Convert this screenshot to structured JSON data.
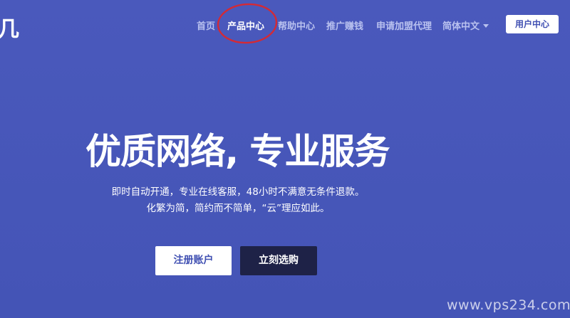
{
  "header": {
    "logo_fragment": "几",
    "nav": {
      "home": "首页",
      "products": "产品中心",
      "help": "帮助中心",
      "affiliate": "推广赚钱",
      "agent": "申请加盟代理",
      "language": "简体中文"
    },
    "user_center": "用户中心"
  },
  "hero": {
    "title": "优质网络, 专业服务",
    "subtitle_line1": "即时自动开通，专业在线客服，48小时不满意无条件退款。",
    "subtitle_line2": "化繁为简，简约而不简单，“云”理应如此。",
    "register_button": "注册账户",
    "buy_button": "立刻选购"
  },
  "watermark": "www.vps234.com",
  "colors": {
    "background": "#4656b8",
    "nav_inactive": "#b9c1ef",
    "nav_active": "#ffffff",
    "buy_button": "#1e2247",
    "annotation_circle": "#d42a35"
  }
}
